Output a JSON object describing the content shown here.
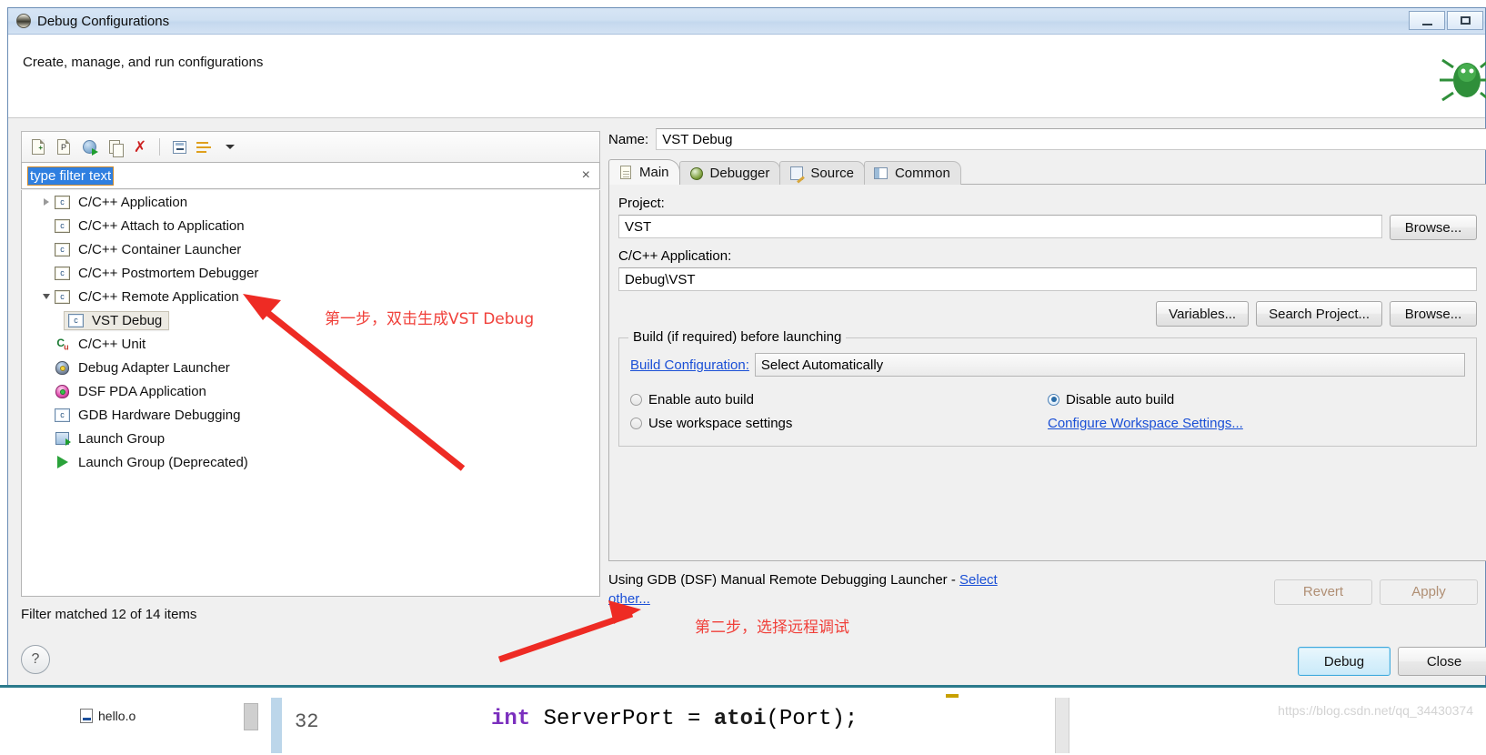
{
  "window": {
    "title": "Debug Configurations",
    "icon": "eclipse-icon",
    "minimize_label": "Minimize",
    "maximize_label": "Maximize"
  },
  "header": {
    "description": "Create, manage, and run configurations",
    "decoration_icon": "bug-icon"
  },
  "left_panel": {
    "toolbar": [
      {
        "name": "new-configuration-icon",
        "tooltip": "New launch configuration"
      },
      {
        "name": "new-prototype-icon",
        "tooltip": "New prototype"
      },
      {
        "name": "export-icon",
        "tooltip": "Export launch configuration"
      },
      {
        "name": "duplicate-icon",
        "tooltip": "Duplicate"
      },
      {
        "name": "delete-icon",
        "tooltip": "Delete"
      },
      {
        "name": "collapse-all-icon",
        "tooltip": "Collapse All"
      },
      {
        "name": "filter-icon",
        "tooltip": "Filter launch configurations"
      },
      {
        "name": "chevron-down-icon",
        "tooltip": "View menu"
      }
    ],
    "filter": {
      "value": "type filter text",
      "placeholder": "type filter text",
      "clear_glyph": "×"
    },
    "tree": [
      {
        "label": "C/C++ Application",
        "icon": "c-file-icon",
        "twisty": "collapsed",
        "indent": 0,
        "selected": false
      },
      {
        "label": "C/C++ Attach to Application",
        "icon": "c-file-icon",
        "twisty": "none",
        "indent": 0,
        "selected": false
      },
      {
        "label": "C/C++ Container Launcher",
        "icon": "c-file-icon",
        "twisty": "none",
        "indent": 0,
        "selected": false
      },
      {
        "label": "C/C++ Postmortem Debugger",
        "icon": "c-file-icon",
        "twisty": "none",
        "indent": 0,
        "selected": false
      },
      {
        "label": "C/C++ Remote Application",
        "icon": "c-file-icon",
        "twisty": "expanded",
        "indent": 0,
        "selected": false
      },
      {
        "label": "VST Debug",
        "icon": "c-file-icon-blue",
        "twisty": "none",
        "indent": 1,
        "selected": true
      },
      {
        "label": "C/C++ Unit",
        "icon": "cunit-icon",
        "twisty": "none",
        "indent": 0,
        "selected": false
      },
      {
        "label": "Debug Adapter Launcher",
        "icon": "bug-blue-icon",
        "twisty": "none",
        "indent": 0,
        "selected": false
      },
      {
        "label": "DSF PDA Application",
        "icon": "bug-pink-icon",
        "twisty": "none",
        "indent": 0,
        "selected": false
      },
      {
        "label": "GDB Hardware Debugging",
        "icon": "c-file-icon-blue",
        "twisty": "none",
        "indent": 0,
        "selected": false
      },
      {
        "label": "Launch Group",
        "icon": "launch-group-icon",
        "twisty": "none",
        "indent": 0,
        "selected": false
      },
      {
        "label": "Launch Group (Deprecated)",
        "icon": "play-icon",
        "twisty": "none",
        "indent": 0,
        "selected": false
      }
    ],
    "footer_status": "Filter matched 12 of 14 items"
  },
  "right_panel": {
    "name_label": "Name:",
    "name_value": "VST Debug",
    "tabs": [
      {
        "label": "Main",
        "icon": "document-icon",
        "active": true
      },
      {
        "label": "Debugger",
        "icon": "bug-icon",
        "active": false
      },
      {
        "label": "Source",
        "icon": "source-icon",
        "active": false
      },
      {
        "label": "Common",
        "icon": "common-icon",
        "active": false
      }
    ],
    "project_label": "Project:",
    "project_value": "VST",
    "application_label": "C/C++ Application:",
    "application_value": "Debug\\VST",
    "buttons": {
      "variables": "Variables...",
      "search_project": "Search Project...",
      "browse": "Browse...",
      "browse_project": "Browse..."
    },
    "build_group": {
      "title": "Build (if required) before launching",
      "build_configuration_link": "Build Configuration:",
      "build_configuration_value": "Select Automatically",
      "options": [
        {
          "label": "Enable auto build",
          "checked": false
        },
        {
          "label": "Disable auto build",
          "checked": true
        },
        {
          "label": "Use workspace settings",
          "checked": false
        }
      ],
      "configure_workspace_link": "Configure Workspace Settings..."
    },
    "status_text": "Using GDB (DSF) Manual Remote Debugging Launcher - ",
    "status_link_1": "Select",
    "status_link_2": "other...",
    "revert_button": "Revert",
    "apply_button": "Apply"
  },
  "footer": {
    "help_glyph": "?",
    "debug_button": "Debug",
    "close_button": "Close"
  },
  "annotations": [
    {
      "text": "第一步，双击生成VST Debug",
      "color": "#f0403a"
    },
    {
      "text": "第二步，选择远程调试",
      "color": "#f0403a"
    }
  ],
  "background_editor": {
    "file_tab": "hello.o",
    "line_number": "32",
    "code_keyword": "int",
    "code_rest": " ServerPort = ",
    "code_call": "atoi",
    "code_tail": "(Port);",
    "watermark": "https://blog.csdn.net/qq_34430374"
  },
  "colors": {
    "accent": "#1a4fd6",
    "annotation": "#f0403a",
    "selection": "#2f7fe0",
    "default_button_border": "#3fa9dd"
  }
}
